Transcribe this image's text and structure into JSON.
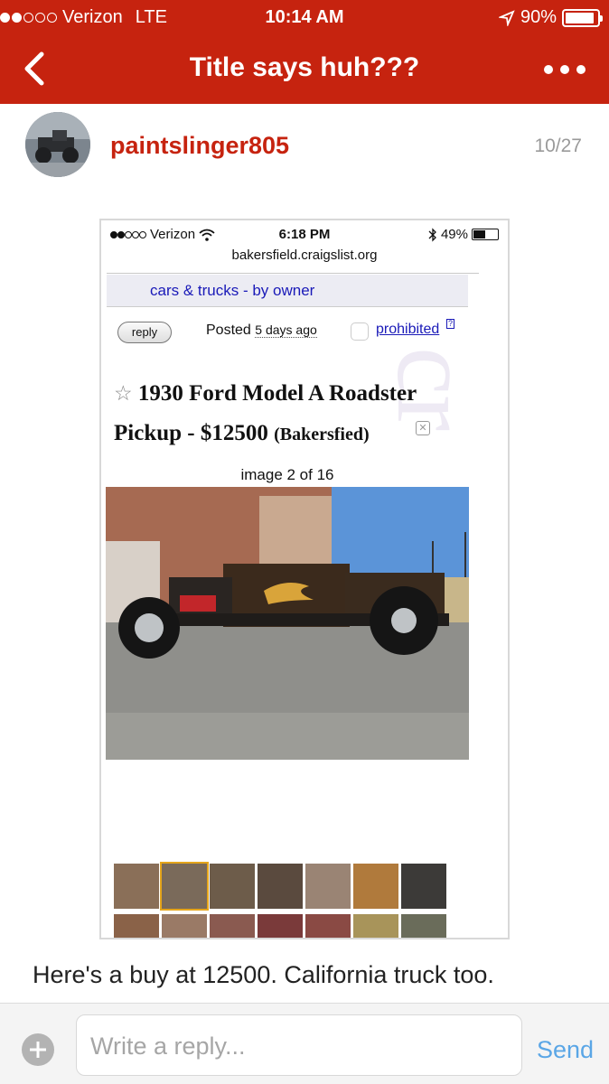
{
  "status_bar": {
    "carrier": "Verizon",
    "network": "LTE",
    "time": "10:14 AM",
    "battery": "90%",
    "battery_level": 0.9
  },
  "nav": {
    "back_icon": "chevron-left-icon",
    "title": "Title says huh???",
    "more_icon": "more-dots-icon"
  },
  "post": {
    "username": "paintslinger805",
    "date": "10/27",
    "body": "Here's a buy at 12500. California truck too."
  },
  "embedded_screenshot": {
    "status_bar": {
      "carrier": "Verizon",
      "time": "6:18 PM",
      "battery": "49%",
      "battery_level": 0.49
    },
    "url": "bakersfield.craigslist.org",
    "breadcrumb": "cars & trucks - by owner",
    "reply_label": "reply",
    "posted_label": "Posted",
    "posted_ago": "5 days ago",
    "prohibited_label": "prohibited",
    "help_mark": "?",
    "listing_title": "1930 Ford Model A Roadster Pickup - $12500",
    "listing_location": "(Bakersfied)",
    "image_label": "image 2 of 16",
    "thumbnails_count": 14,
    "selected_thumbnail": 2
  },
  "composer": {
    "add_icon": "plus-circle-icon",
    "placeholder": "Write a reply...",
    "send_label": "Send"
  },
  "colors": {
    "brand": "#c6230f",
    "send": "#5aa6e6",
    "link": "#1a1ab8"
  }
}
